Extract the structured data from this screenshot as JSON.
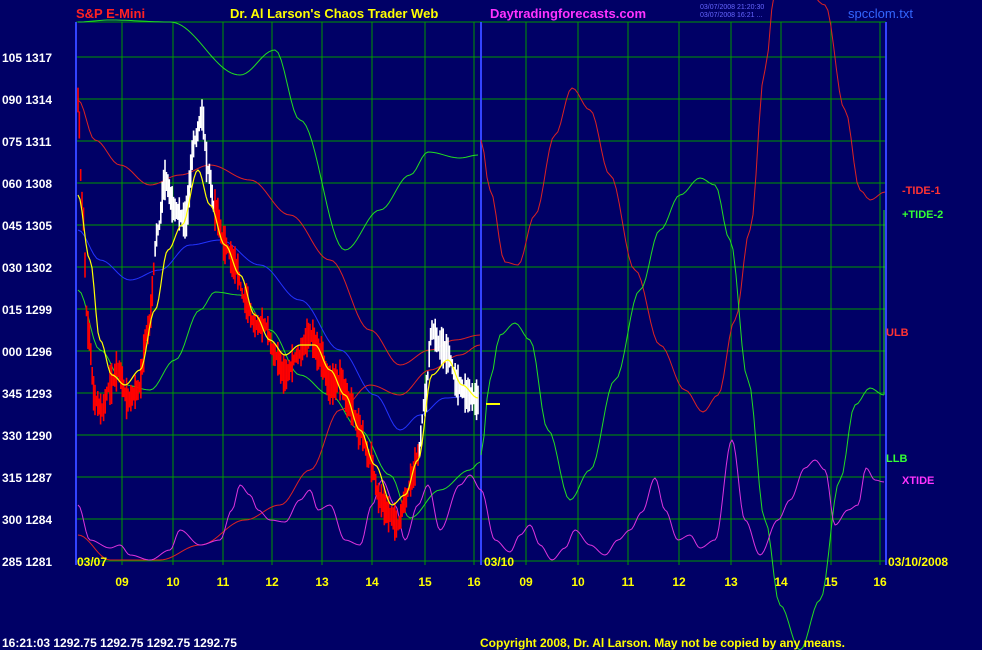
{
  "header": {
    "left_title": "S&P E-Mini",
    "center_title": "Dr. Al Larson's Chaos Trader Web",
    "site": "Daytradingforecasts.com",
    "timestamp1": "03/07/2008 21:20:30",
    "timestamp2": "03/07/2008 16:21 ...",
    "file": "spcclom.txt"
  },
  "footer": {
    "quote": "16:21:03  1292.75 1292.75 1292.75 1292.75",
    "copyright": "Copyright 2008, Dr. Al Larson. May not be copied by any means."
  },
  "colors": {
    "background": "#000066",
    "grid": "#009900",
    "price_white": "#ffffff",
    "price_red": "#ff0000",
    "yellow": "#ffff00",
    "tide1": "#dd2222",
    "tide2": "#22dd22",
    "xtide": "#dd33dd",
    "blue_band": "#2233ff"
  },
  "chart_data": {
    "type": "line",
    "title": "S&P E-Mini",
    "y_axis_labels": [
      {
        "deg": "105",
        "price": "1317"
      },
      {
        "deg": "090",
        "price": "1314"
      },
      {
        "deg": "075",
        "price": "1311"
      },
      {
        "deg": "060",
        "price": "1308"
      },
      {
        "deg": "045",
        "price": "1305"
      },
      {
        "deg": "030",
        "price": "1302"
      },
      {
        "deg": "015",
        "price": "1299"
      },
      {
        "deg": "000",
        "price": "1296"
      },
      {
        "deg": "345",
        "price": "1293"
      },
      {
        "deg": "330",
        "price": "1290"
      },
      {
        "deg": "315",
        "price": "1287"
      },
      {
        "deg": "300",
        "price": "1284"
      },
      {
        "deg": "285",
        "price": "1281"
      }
    ],
    "ylim": [
      1281,
      1317
    ],
    "x_ticks_left": [
      "09",
      "10",
      "11",
      "12",
      "13",
      "14",
      "15",
      "16"
    ],
    "x_ticks_right": [
      "09",
      "10",
      "11",
      "12",
      "13",
      "14",
      "15",
      "16"
    ],
    "date_left": "03/07",
    "date_mid": "03/10",
    "date_right": "03/10/2008",
    "grid": true,
    "series": [
      {
        "name": "-TIDE-1",
        "color": "#dd2222"
      },
      {
        "name": "+TIDE-2",
        "color": "#22dd22"
      },
      {
        "name": "ULB",
        "color": "#dd2222"
      },
      {
        "name": "LLB",
        "color": "#22dd22"
      },
      {
        "name": "XTIDE",
        "color": "#dd33dd"
      }
    ],
    "last_price": 1292.75
  }
}
